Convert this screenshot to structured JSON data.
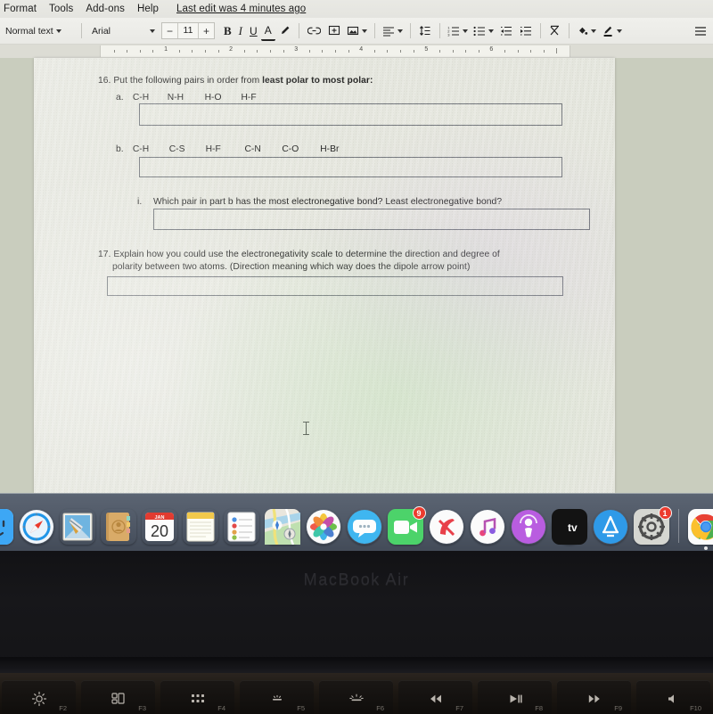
{
  "menubar": {
    "items": [
      "Format",
      "Tools",
      "Add-ons",
      "Help"
    ],
    "last_edit": "Last edit was 4 minutes ago"
  },
  "toolbar": {
    "paragraph_style": "Normal text",
    "font_family": "Arial",
    "font_size": "11",
    "decrease_label": "−",
    "increase_label": "+",
    "bold": "B",
    "italic": "I",
    "underline": "U",
    "text_color": "A",
    "highlight_pen": "highlight-pen-icon",
    "icons": [
      "insert-link-icon",
      "insert-comment-icon",
      "insert-image-icon",
      "align-icon",
      "line-spacing-icon",
      "numbered-list-icon",
      "bulleted-list-icon",
      "decrease-indent-icon",
      "increase-indent-icon",
      "clear-formatting-icon",
      "fill-color-icon",
      "pen-color-icon",
      "more-options-icon"
    ]
  },
  "ruler": {
    "numbers": [
      "1",
      "2",
      "3",
      "4",
      "5",
      "6"
    ],
    "left_indent_marker": "left-indent-marker",
    "right_indent_marker": "right-indent-marker"
  },
  "document": {
    "q16": {
      "number": "16.",
      "text_plain": "Put the following pairs in order from ",
      "text_bold": "least polar to most polar:",
      "a": {
        "label": "a.",
        "pairs": [
          "C-H",
          "N-H",
          "H-O",
          "H-F"
        ]
      },
      "b": {
        "label": "b.",
        "pairs": [
          "C-H",
          "C-S",
          "H-F",
          "C-N",
          "C-O",
          "H-Br"
        ]
      },
      "i": {
        "label": "i.",
        "text": "Which pair in part b has the most electronegative bond? Least electronegative bond?"
      }
    },
    "q17": {
      "number": "17.",
      "line1": "Explain how you could use the electronegativity scale to determine the direction and degree of",
      "line2": "polarity between two atoms. (Direction meaning which way does the dipole arrow point)"
    },
    "cursor": "text-ibeam-cursor"
  },
  "dock": {
    "items": [
      {
        "name": "finder",
        "label": "Finder",
        "badge": ""
      },
      {
        "name": "safari",
        "label": "Safari",
        "badge": ""
      },
      {
        "name": "mail",
        "label": "Mail",
        "badge": ""
      },
      {
        "name": "contacts",
        "label": "Contacts",
        "badge": ""
      },
      {
        "name": "calendar",
        "label": "Calendar",
        "badge": "",
        "month": "JAN",
        "day": "20"
      },
      {
        "name": "notes",
        "label": "Notes",
        "badge": ""
      },
      {
        "name": "reminders",
        "label": "Reminders",
        "badge": ""
      },
      {
        "name": "maps",
        "label": "Maps",
        "badge": ""
      },
      {
        "name": "photos",
        "label": "Photos",
        "badge": ""
      },
      {
        "name": "messages",
        "label": "Messages",
        "badge": ""
      },
      {
        "name": "facetime",
        "label": "FaceTime",
        "badge": "9"
      },
      {
        "name": "news",
        "label": "News",
        "badge": ""
      },
      {
        "name": "music",
        "label": "Music",
        "badge": ""
      },
      {
        "name": "podcasts",
        "label": "Podcasts",
        "badge": ""
      },
      {
        "name": "apple-tv",
        "label": "Apple TV",
        "badge": ""
      },
      {
        "name": "app-store",
        "label": "App Store",
        "badge": ""
      },
      {
        "name": "system-preferences",
        "label": "System Preferences",
        "badge": "1"
      },
      {
        "name": "google-chrome",
        "label": "Google Chrome",
        "badge": ""
      }
    ]
  },
  "laptop": {
    "model": "MacBook Air",
    "function_keys": [
      {
        "key": "F2",
        "glyph": "brightness-up-icon"
      },
      {
        "key": "F3",
        "glyph": "mission-control-icon"
      },
      {
        "key": "F4",
        "glyph": "launchpad-icon"
      },
      {
        "key": "F5",
        "glyph": "keyboard-backlight-down-icon"
      },
      {
        "key": "F6",
        "glyph": "keyboard-backlight-up-icon"
      },
      {
        "key": "F7",
        "glyph": "rewind-icon"
      },
      {
        "key": "F8",
        "glyph": "play-pause-icon"
      },
      {
        "key": "F9",
        "glyph": "fast-forward-icon"
      },
      {
        "key": "F10",
        "glyph": "mute-icon"
      }
    ],
    "fkey_glyph_text": [
      "☀",
      "",
      "",
      "∙̇∙",
      "∙̊∙",
      "◂◂",
      "▸‖",
      "▸▸",
      "◂"
    ]
  },
  "colors": {
    "page": "#e7e8e0",
    "canvas": "#c9cdbe",
    "toolbar": "#eeeeea",
    "dock": "#4f5866",
    "accent_blue": "#2c66c4",
    "badge_red": "#ec3b2e"
  }
}
